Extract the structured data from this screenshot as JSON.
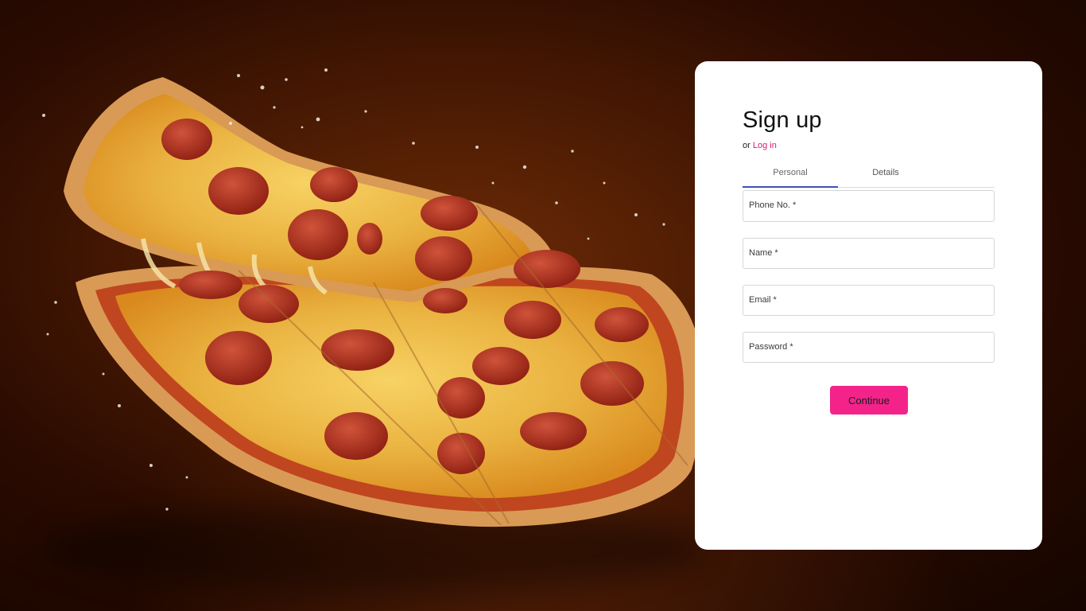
{
  "signup": {
    "title": "Sign up",
    "subtitle_prefix": "or",
    "login_link": "Log in",
    "tabs": [
      {
        "label": "Personal",
        "active": true
      },
      {
        "label": "Details",
        "active": false
      }
    ],
    "fields": {
      "phone": "Phone No. *",
      "name": "Name *",
      "email": "Email *",
      "password": "Password *"
    },
    "continue_label": "Continue"
  },
  "colors": {
    "accent": "#f3238a",
    "link": "#d81b74",
    "tab_indicator": "#3f51b5",
    "background": "#4a1a03"
  }
}
